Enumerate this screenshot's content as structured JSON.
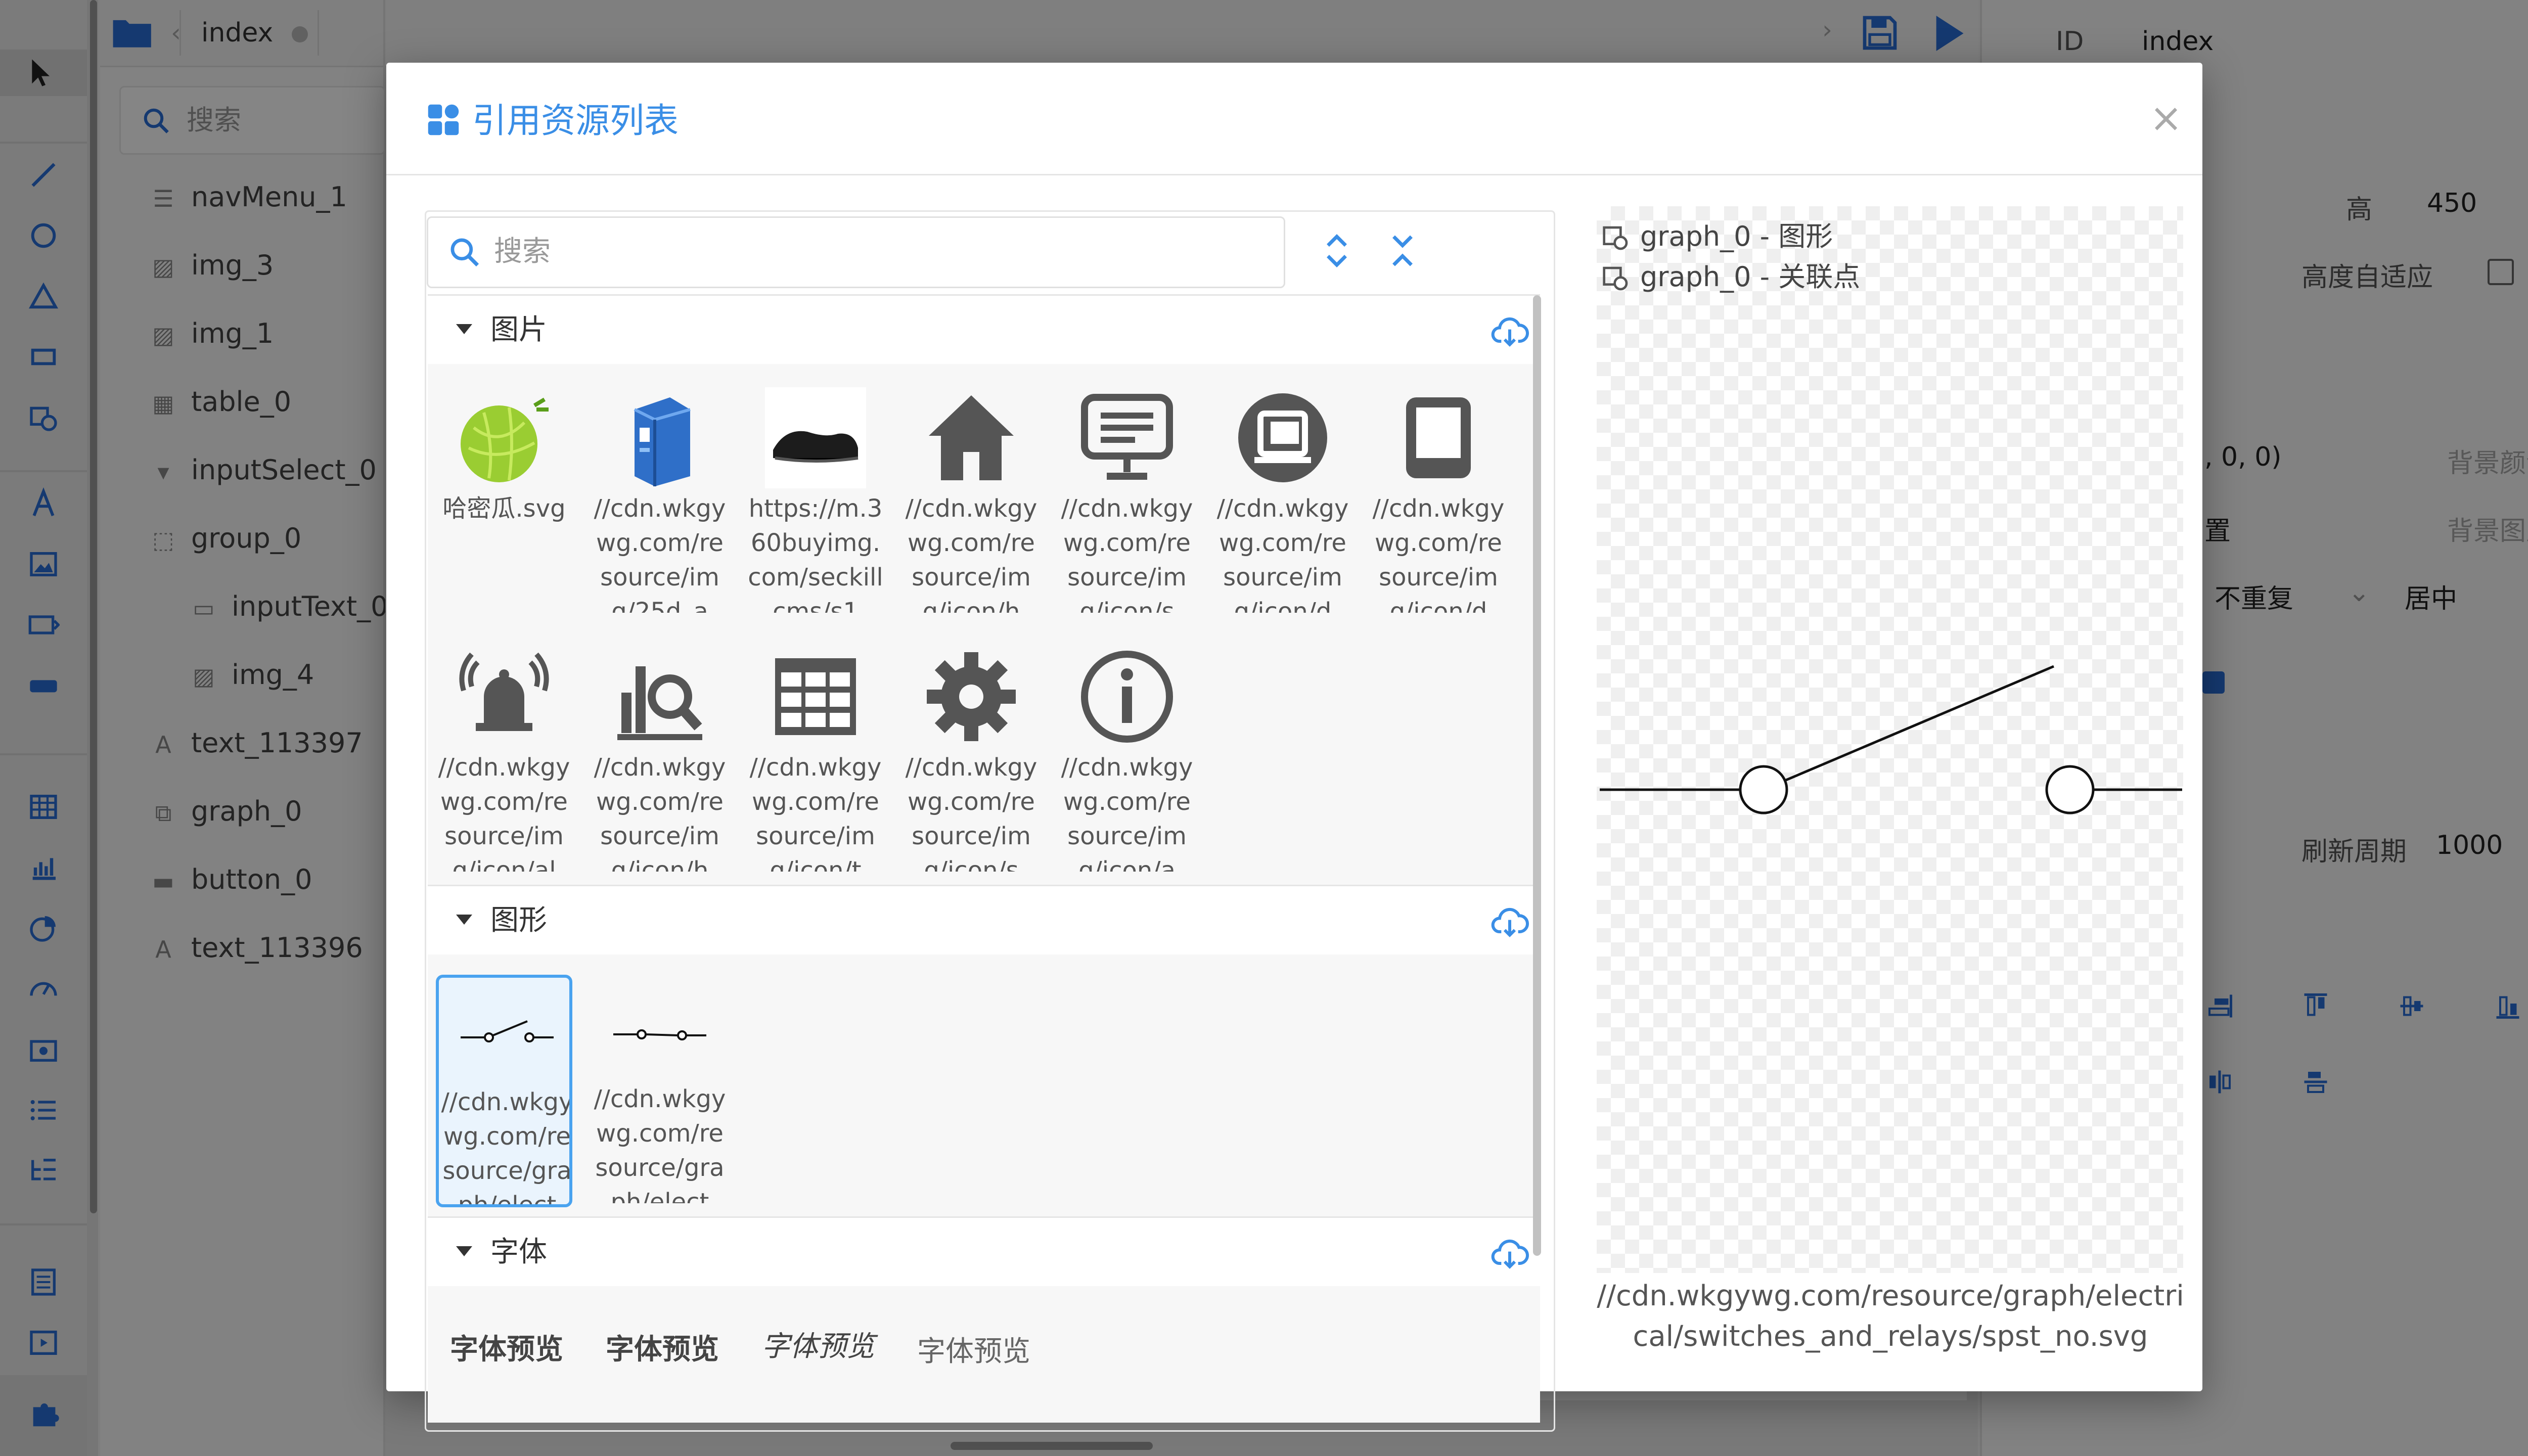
{
  "background_app": {
    "file_tab": "index",
    "layer_search_placeholder": "搜索",
    "layers": [
      {
        "label": "navMenu_1",
        "icon": "list-icon"
      },
      {
        "label": "img_3",
        "icon": "image-icon"
      },
      {
        "label": "img_1",
        "icon": "image-icon"
      },
      {
        "label": "table_0",
        "icon": "table-icon"
      },
      {
        "label": "inputSelect_0",
        "icon": "select-icon"
      },
      {
        "label": "group_0",
        "icon": "group-icon"
      },
      {
        "label": "inputText_0",
        "icon": "textbox-icon"
      },
      {
        "label": "img_4",
        "icon": "image-icon"
      },
      {
        "label": "text_113397",
        "icon": "text-icon"
      },
      {
        "label": "graph_0",
        "icon": "graph-icon"
      },
      {
        "label": "button_0",
        "icon": "button-icon"
      },
      {
        "label": "text_113396",
        "icon": "text-icon"
      }
    ],
    "props": {
      "id_label": "ID",
      "id_value": "index",
      "height_label": "高",
      "height_value": "450",
      "auto_height_label": "高度自适应",
      "bg_color_value": ", 0, 0)",
      "bg_color_label": "背景颜色",
      "bg_image_fragment": "置",
      "bg_image_label": "背景图片",
      "repeat_value": "不重复",
      "position_value": "居中",
      "refresh_label": "刷新周期",
      "refresh_value": "1000"
    }
  },
  "modal": {
    "title": "引用资源列表",
    "close_label": "×",
    "search_placeholder": "搜索",
    "sections": {
      "images": {
        "label": "图片",
        "items": [
          {
            "name": "哈密瓜.svg",
            "icon": "melon-icon"
          },
          {
            "name": "//cdn.wkgywg.com/resource/img/25d_a",
            "icon": "cabinet-icon"
          },
          {
            "name": "https://m.360buyimg.com/seckillcms/s1",
            "icon": "shoe-icon"
          },
          {
            "name": "//cdn.wkgywg.com/resource/img/icon/h",
            "icon": "house-icon"
          },
          {
            "name": "//cdn.wkgywg.com/resource/img/icon/s",
            "icon": "monitor-icon"
          },
          {
            "name": "//cdn.wkgywg.com/resource/img/icon/d",
            "icon": "device-icon"
          },
          {
            "name": "//cdn.wkgywg.com/resource/img/icon/d",
            "icon": "tablet-icon"
          },
          {
            "name": "//cdn.wkgywg.com/resource/img/icon/al",
            "icon": "alarm-bell-icon"
          },
          {
            "name": "//cdn.wkgywg.com/resource/img/icon/h",
            "icon": "analytics-icon"
          },
          {
            "name": "//cdn.wkgywg.com/resource/img/icon/t",
            "icon": "grid-table-icon"
          },
          {
            "name": "//cdn.wkgywg.com/resource/img/icon/s",
            "icon": "gear-icon"
          },
          {
            "name": "//cdn.wkgywg.com/resource/img/icon/a",
            "icon": "info-icon"
          }
        ]
      },
      "graphs": {
        "label": "图形",
        "items": [
          {
            "name": "//cdn.wkgywg.com/resource/graph/elect",
            "icon": "switch-open-icon",
            "selected": true
          },
          {
            "name": "//cdn.wkgywg.com/resource/graph/elect",
            "icon": "switch-closed-icon",
            "selected": false
          }
        ]
      },
      "fonts": {
        "label": "字体",
        "previews": [
          "字体预览",
          "字体预览",
          "字体预览",
          "字体预览"
        ]
      }
    },
    "preview": {
      "refs": [
        {
          "label": "graph_0 - 图形",
          "icon": "link-ref-icon"
        },
        {
          "label": "graph_0 - 关联点",
          "icon": "link-ref-icon"
        }
      ],
      "url": "//cdn.wkgywg.com/resource/graph/electrical/switches_and_relays/spst_no.svg"
    }
  },
  "colors": {
    "accent": "#3a8ee6",
    "selection_border": "#4aa3ef",
    "overlay": "rgba(0,0,0,0.48)"
  }
}
